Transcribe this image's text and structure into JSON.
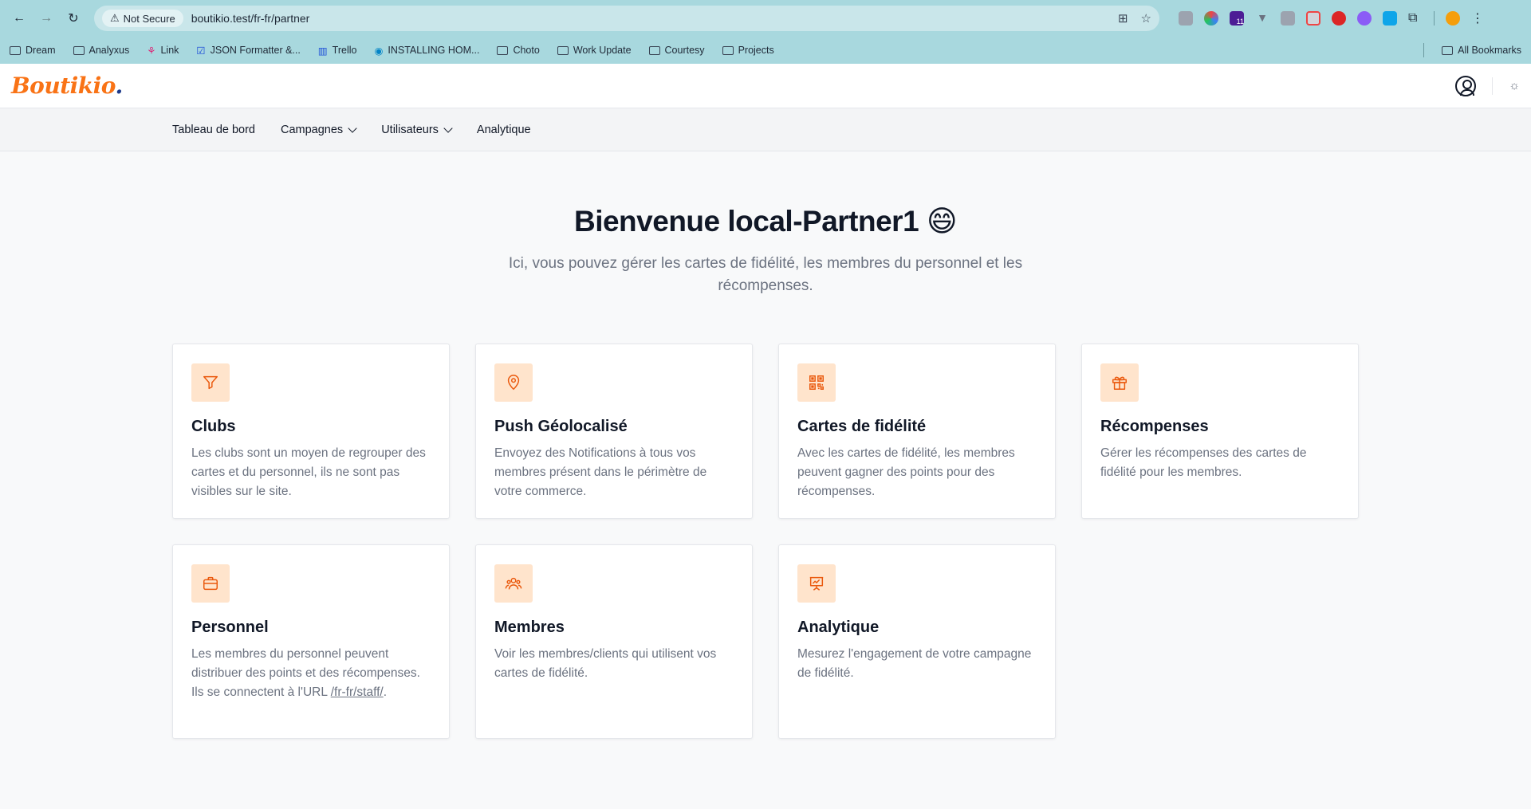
{
  "browser": {
    "security_label": "Not Secure",
    "url": "boutikio.test/fr-fr/partner",
    "extension_badge": "11",
    "bookmarks": [
      {
        "label": "Dream",
        "icon": "folder-icon"
      },
      {
        "label": "Analyxus",
        "icon": "folder-icon"
      },
      {
        "label": "Link",
        "icon": "link-favicon"
      },
      {
        "label": "JSON Formatter &...",
        "icon": "checkbox-favicon"
      },
      {
        "label": "Trello",
        "icon": "trello-favicon"
      },
      {
        "label": "INSTALLING HOM...",
        "icon": "install-favicon"
      },
      {
        "label": "Choto",
        "icon": "folder-icon"
      },
      {
        "label": "Work Update",
        "icon": "folder-icon"
      },
      {
        "label": "Courtesy",
        "icon": "folder-icon"
      },
      {
        "label": "Projects",
        "icon": "folder-icon"
      }
    ],
    "all_bookmarks": "All Bookmarks"
  },
  "app": {
    "logo": "Boutikio",
    "logo_dot": ".",
    "accent_color": "#f97316"
  },
  "nav": {
    "dashboard": "Tableau de bord",
    "campaigns": "Campagnes",
    "users": "Utilisateurs",
    "analytics": "Analytique"
  },
  "hero": {
    "title": "Bienvenue local-Partner1",
    "emoji": "😄",
    "subtitle": "Ici, vous pouvez gérer les cartes de fidélité, les membres du personnel et les récompenses."
  },
  "cards": [
    {
      "icon": "filter-icon",
      "title": "Clubs",
      "desc": "Les clubs sont un moyen de regrouper des cartes et du personnel, ils ne sont pas visibles sur le site."
    },
    {
      "icon": "map-pin-icon",
      "title": "Push Géolocalisé",
      "desc": "Envoyez des Notifications à tous vos membres présent dans le périmètre de votre commerce."
    },
    {
      "icon": "qr-code-icon",
      "title": "Cartes de fidélité",
      "desc": "Avec les cartes de fidélité, les membres peuvent gagner des points pour des récompenses."
    },
    {
      "icon": "gift-icon",
      "title": "Récompenses",
      "desc": "Gérer les récompenses des cartes de fidélité pour les membres."
    },
    {
      "icon": "briefcase-icon",
      "title": "Personnel",
      "desc": "Les membres du personnel peuvent distribuer des points et des récompenses. Ils se connectent à l'URL ",
      "link": "/fr-fr/staff/",
      "desc_end": "."
    },
    {
      "icon": "users-icon",
      "title": "Membres",
      "desc": "Voir les membres/clients qui utilisent vos cartes de fidélité."
    },
    {
      "icon": "presentation-chart-icon",
      "title": "Analytique",
      "desc": "Mesurez l'engagement de votre campagne de fidélité."
    }
  ]
}
